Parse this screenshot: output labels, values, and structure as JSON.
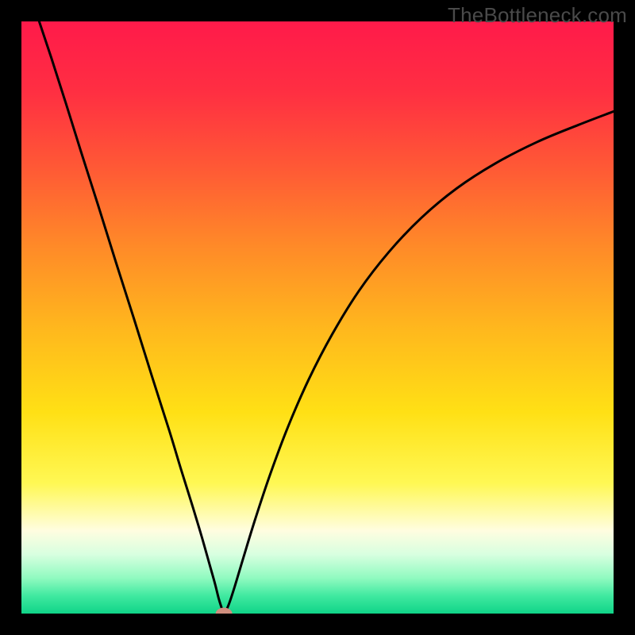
{
  "watermark": {
    "text": "TheBottleneck.com"
  },
  "colors": {
    "frame": "#000000",
    "curve": "#000000",
    "marker_fill": "#cf8e7e",
    "gradient_stops": [
      {
        "offset": 0.0,
        "color": "#ff1a4a"
      },
      {
        "offset": 0.12,
        "color": "#ff2f42"
      },
      {
        "offset": 0.25,
        "color": "#ff5a35"
      },
      {
        "offset": 0.38,
        "color": "#ff8a28"
      },
      {
        "offset": 0.52,
        "color": "#ffb81d"
      },
      {
        "offset": 0.66,
        "color": "#ffe015"
      },
      {
        "offset": 0.78,
        "color": "#fff854"
      },
      {
        "offset": 0.86,
        "color": "#fffde0"
      },
      {
        "offset": 0.9,
        "color": "#d8ffe0"
      },
      {
        "offset": 0.94,
        "color": "#90fac0"
      },
      {
        "offset": 0.97,
        "color": "#40e9a0"
      },
      {
        "offset": 1.0,
        "color": "#10d488"
      }
    ]
  },
  "chart_data": {
    "type": "line",
    "title": "",
    "xlabel": "",
    "ylabel": "",
    "xlim": [
      0,
      1
    ],
    "ylim": [
      0,
      1
    ],
    "series": [
      {
        "name": "curve",
        "x": [
          0.03,
          0.05,
          0.075,
          0.1,
          0.13,
          0.16,
          0.19,
          0.22,
          0.25,
          0.27,
          0.29,
          0.305,
          0.318,
          0.327,
          0.333,
          0.338,
          0.342,
          0.35,
          0.36,
          0.375,
          0.395,
          0.42,
          0.45,
          0.485,
          0.525,
          0.57,
          0.62,
          0.675,
          0.735,
          0.8,
          0.87,
          0.94,
          1.0
        ],
        "y": [
          1.0,
          0.94,
          0.862,
          0.782,
          0.688,
          0.592,
          0.498,
          0.402,
          0.308,
          0.242,
          0.178,
          0.128,
          0.082,
          0.05,
          0.026,
          0.01,
          0.0,
          0.015,
          0.045,
          0.095,
          0.16,
          0.235,
          0.315,
          0.395,
          0.472,
          0.545,
          0.61,
          0.668,
          0.718,
          0.76,
          0.796,
          0.825,
          0.848
        ]
      }
    ],
    "marker": {
      "x": 0.342,
      "y": 0.0,
      "rx": 0.014,
      "ry": 0.01
    }
  }
}
